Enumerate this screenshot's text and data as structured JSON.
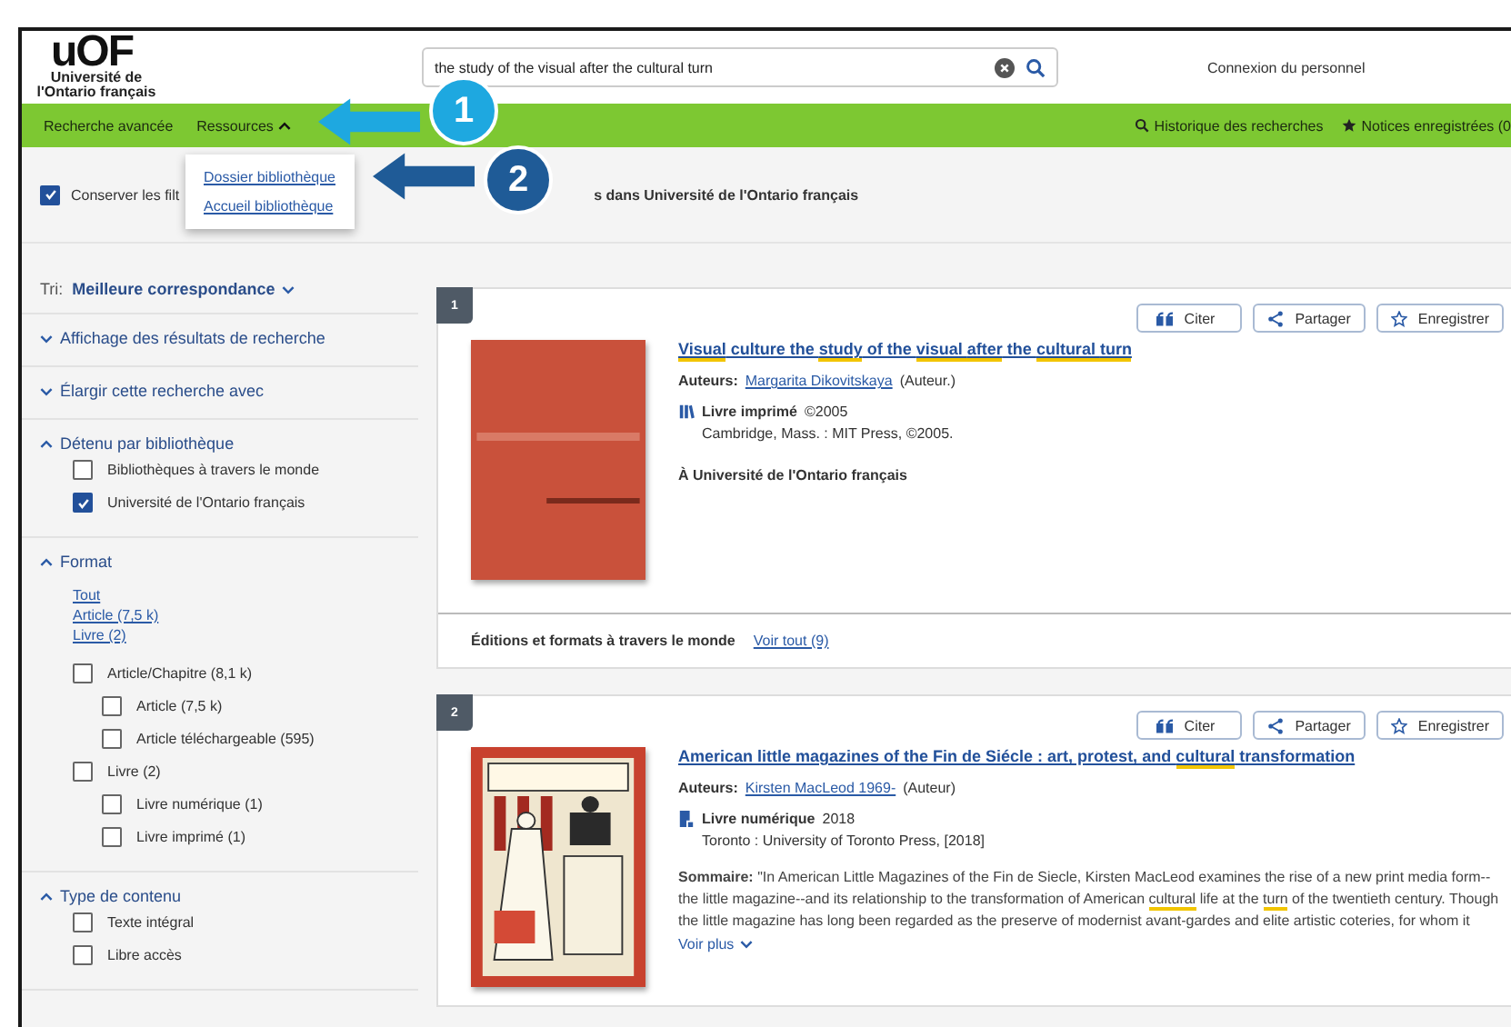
{
  "logo": {
    "mark": "uOF",
    "name": "Université de l'Ontario français"
  },
  "search": {
    "value": "the study of the visual after the cultural turn"
  },
  "staff_login": "Connexion du personnel",
  "nav": {
    "left": [
      {
        "label": "Recherche avancée"
      },
      {
        "label": "Ressources",
        "expanded": true
      }
    ],
    "right": [
      {
        "label": "Historique des recherches"
      },
      {
        "label": "Notices enregistrées (0"
      }
    ]
  },
  "dropdown": [
    "Dossier bibliothèque",
    "Accueil bibliothèque"
  ],
  "callouts": [
    {
      "label": "1",
      "color": "#1ea8e0"
    },
    {
      "label": "2",
      "color": "#1f5b97"
    }
  ],
  "filter_bar": {
    "keep_filters": {
      "label": "Conserver les filt",
      "checked": true
    },
    "results_text": "s dans Université de l'Ontario français"
  },
  "sidebar": {
    "sort_label": "Tri:",
    "sort_value": "Meilleure correspondance",
    "sections": [
      {
        "title": "Affichage des résultats de recherche",
        "expanded": false
      },
      {
        "title": "Élargir cette recherche avec",
        "expanded": false
      },
      {
        "title": "Détenu par bibliothèque",
        "expanded": true,
        "options": [
          {
            "label": "Bibliothèques à travers le monde",
            "checked": false
          },
          {
            "label": "Université de l'Ontario français",
            "checked": true
          }
        ]
      },
      {
        "title": "Format",
        "expanded": true,
        "links": [
          "Tout",
          "Article (7,5 k)",
          "Livre (2)"
        ],
        "options": [
          {
            "label": "Article/Chapitre (8,1 k)",
            "checked": false,
            "children": [
              {
                "label": "Article (7,5 k)",
                "checked": false
              },
              {
                "label": "Article téléchargeable (595)",
                "checked": false
              }
            ]
          },
          {
            "label": "Livre (2)",
            "checked": false,
            "children": [
              {
                "label": "Livre numérique (1)",
                "checked": false
              },
              {
                "label": "Livre imprimé (1)",
                "checked": false
              }
            ]
          }
        ]
      },
      {
        "title": "Type de contenu",
        "expanded": true,
        "options": [
          {
            "label": "Texte intégral",
            "checked": false
          },
          {
            "label": "Libre accès",
            "checked": false
          }
        ]
      }
    ]
  },
  "results": [
    {
      "number": "1",
      "actions": [
        "Citer",
        "Partager",
        "Enregistrer"
      ],
      "title": [
        {
          "text": "Visual",
          "highlight": true
        },
        {
          "text": " culture the ",
          "highlight": false
        },
        {
          "text": "study",
          "highlight": true
        },
        {
          "text": " of the ",
          "highlight": false
        },
        {
          "text": "visual ",
          "highlight": true
        },
        {
          "text": "after",
          "highlight": true
        },
        {
          "text": " the ",
          "highlight": false
        },
        {
          "text": "cultural ",
          "highlight": true
        },
        {
          "text": "turn",
          "highlight": true
        }
      ],
      "authors_label": "Auteurs:",
      "author": "Margarita Dikovitskaya",
      "role": "(Auteur.)",
      "format": "Livre imprimé",
      "year": "©2005",
      "publisher": "Cambridge, Mass. : MIT Press, ©2005.",
      "holding": "À Université de l'Ontario français",
      "editions_label": "Éditions et formats à travers le monde",
      "editions_link": "Voir tout (9)"
    },
    {
      "number": "2",
      "actions": [
        "Citer",
        "Partager",
        "Enregistrer"
      ],
      "title": [
        {
          "text": "American little magazines of the Fin de Siécle : art, protest, and ",
          "highlight": false
        },
        {
          "text": "cultural",
          "highlight": true
        },
        {
          "text": " transformation",
          "highlight": false
        }
      ],
      "authors_label": "Auteurs:",
      "author": "Kirsten MacLeod 1969-",
      "role": "(Auteur)",
      "format": "Livre numérique",
      "year": "2018",
      "publisher": "Toronto : University of Toronto Press, [2018]",
      "summary_label": "Sommaire:",
      "summary": [
        {
          "text": "\"In American Little Magazines of the Fin de Siecle, Kirsten MacLeod examines the rise of a new print media form--the little magazine--and its relationship to the transformation of American ",
          "highlight": false
        },
        {
          "text": "cultural",
          "highlight": true
        },
        {
          "text": " life at the ",
          "highlight": false
        },
        {
          "text": "turn",
          "highlight": true
        },
        {
          "text": " of the twentieth century. Though the little magazine has long been regarded as the preserve of modernist avant-gardes and elite artistic coteries, for whom it",
          "highlight": false
        }
      ],
      "more": "Voir plus"
    }
  ]
}
